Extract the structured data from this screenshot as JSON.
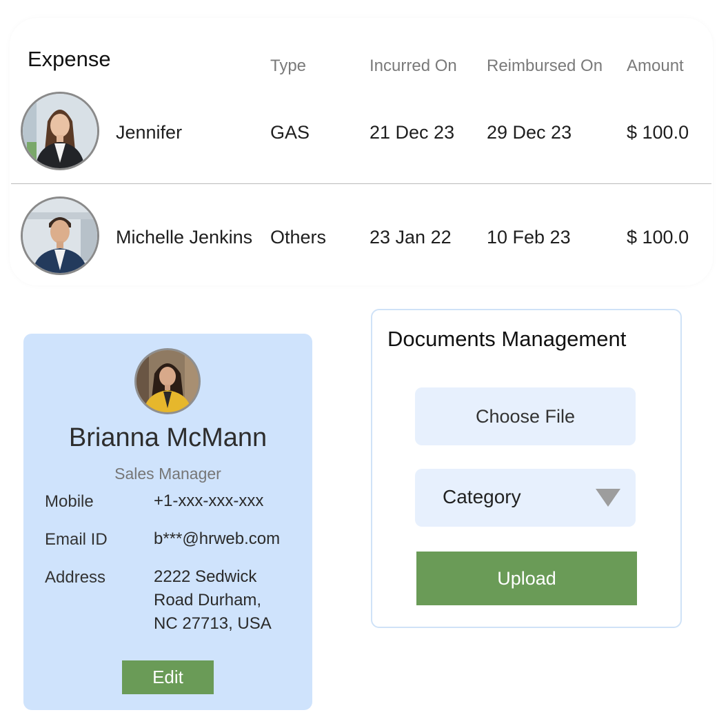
{
  "expense": {
    "title": "Expense",
    "columns": {
      "type": "Type",
      "incurred_on": "Incurred On",
      "reimbursed_on": "Reimbursed On",
      "amount": "Amount"
    },
    "rows": [
      {
        "name": "Jennifer",
        "type": "GAS",
        "incurred_on": "21 Dec 23",
        "reimbursed_on": "29 Dec 23",
        "amount": "$ 100.0",
        "avatar": "woman-portrait"
      },
      {
        "name": "Michelle Jenkins",
        "type": "Others",
        "incurred_on": "23 Jan 22",
        "reimbursed_on": "10 Feb 23",
        "amount": "$ 100.0",
        "avatar": "man-portrait"
      }
    ]
  },
  "profile": {
    "name": "Brianna McMann",
    "role": "Sales Manager",
    "avatar": "woman-portrait",
    "fields": [
      {
        "label": "Mobile",
        "value": "+1-xxx-xxx-xxx"
      },
      {
        "label": "Email ID",
        "value": "b***@hrweb.com"
      },
      {
        "label": "Address",
        "value": "2222 Sedwick\nRoad Durham,\nNC 27713, USA"
      }
    ],
    "edit_label": "Edit"
  },
  "documents": {
    "title": "Documents Management",
    "choose_file_label": "Choose File",
    "category_label": "Category",
    "upload_label": "Upload"
  },
  "colors": {
    "profile_bg": "#cfe3fc",
    "button_green": "#6a9b57",
    "input_bg": "#e7f0fd",
    "doc_border": "#cfe2f7"
  }
}
